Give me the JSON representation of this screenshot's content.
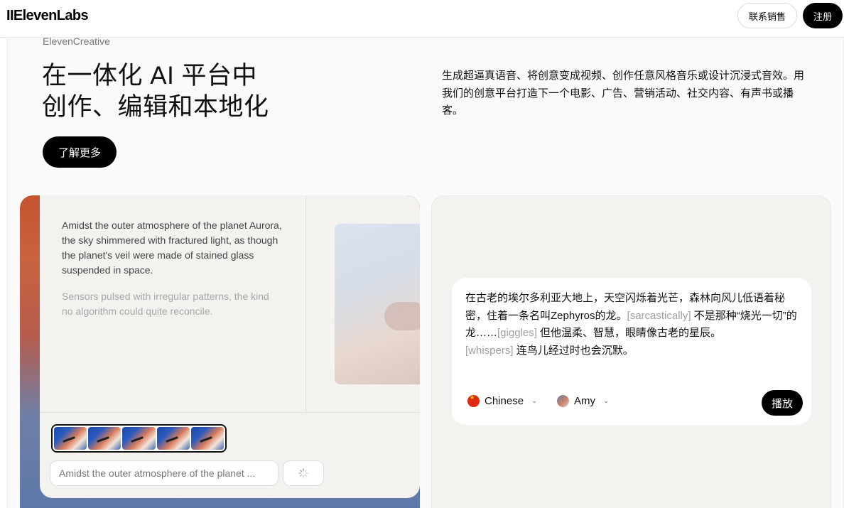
{
  "nav": {
    "logo": "IIElevenLabs",
    "sales_label": "联系销售",
    "signup_label": "注册"
  },
  "hero": {
    "eyebrow": "ElevenCreative",
    "headline_line1": "在一体化 AI 平台中",
    "headline_line2": "创作、编辑和本地化",
    "description": "生成超逼真语音、将创意变成视频、创作任意风格音乐或设计沉浸式音效。用我们的创意平台打造下一个电影、广告、营销活动、社交内容、有声书或播客。",
    "learn_more_label": "了解更多"
  },
  "video_card": {
    "story_paragraph_1": "Amidst the outer atmosphere of the planet Aurora, the sky shimmered with fractured light, as though the planet's veil were made of stained glass suspended in space.",
    "story_paragraph_2": "Sensors pulsed with irregular patterns, the kind no algorithm could quite reconcile.",
    "prompt_value": "Amidst the outer atmosphere of the planet ...",
    "frame_count": 5
  },
  "tts_card": {
    "text_part1": "在古老的埃尔多利亚大地上，天空闪烁着光芒，森林向风儿低语着秘密，住着一条名叫Zephyros的龙。",
    "tag1": "[sarcastically]",
    "text_part2": " 不是那种“烧光一切”的龙……",
    "tag2": "[giggles]",
    "text_part3": " 但他温柔、智慧，眼睛像古老的星辰。",
    "tag3": "[whispers]",
    "text_part4": " 连鸟儿经过时也会沉默。",
    "language": "Chinese",
    "voice": "Amy",
    "play_label": "播放"
  }
}
